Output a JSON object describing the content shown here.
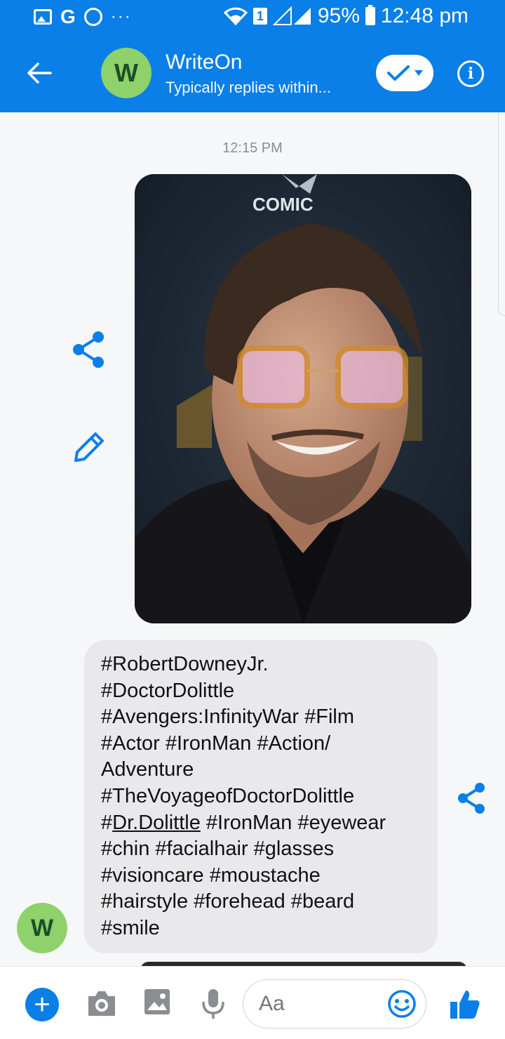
{
  "status_bar": {
    "left_icons": [
      "gallery-icon",
      "google-icon",
      "whatsapp-icon",
      "more-dots-icon"
    ],
    "google_letter": "G",
    "dots": "···",
    "sim_label": "1",
    "battery": "95%",
    "time": "12:48 pm"
  },
  "header": {
    "back_icon": "arrow-left-icon",
    "avatar_letter": "W",
    "name": "WriteOn",
    "status": "Typically replies within...",
    "info_label": "i"
  },
  "conversation": {
    "timestamp": "12:15 PM",
    "photo_caption": "COMIC",
    "text_lines": [
      "#RobertDowneyJr.",
      "#DoctorDolittle",
      "#Avengers:InfinityWar #Film",
      "#Actor #IronMan #Action/",
      "Adventure",
      "#TheVoyageofDoctorDolittle"
    ],
    "line7_prefix": "#",
    "line7_link": "Dr.Dolittle",
    "line7_suffix": " #IronMan #eyewear",
    "text_lines_tail": [
      "#chin #facialhair #glasses",
      "#visioncare #moustache",
      "#hairstyle #forehead #beard",
      "#smile"
    ],
    "sender_avatar_letter": "W"
  },
  "composer": {
    "plus_label": "+",
    "placeholder": "Aa"
  },
  "colors": {
    "brand": "#0a7fe8",
    "avatar_bg": "#8fd16a",
    "bubble_bg": "#e9e9eb"
  }
}
